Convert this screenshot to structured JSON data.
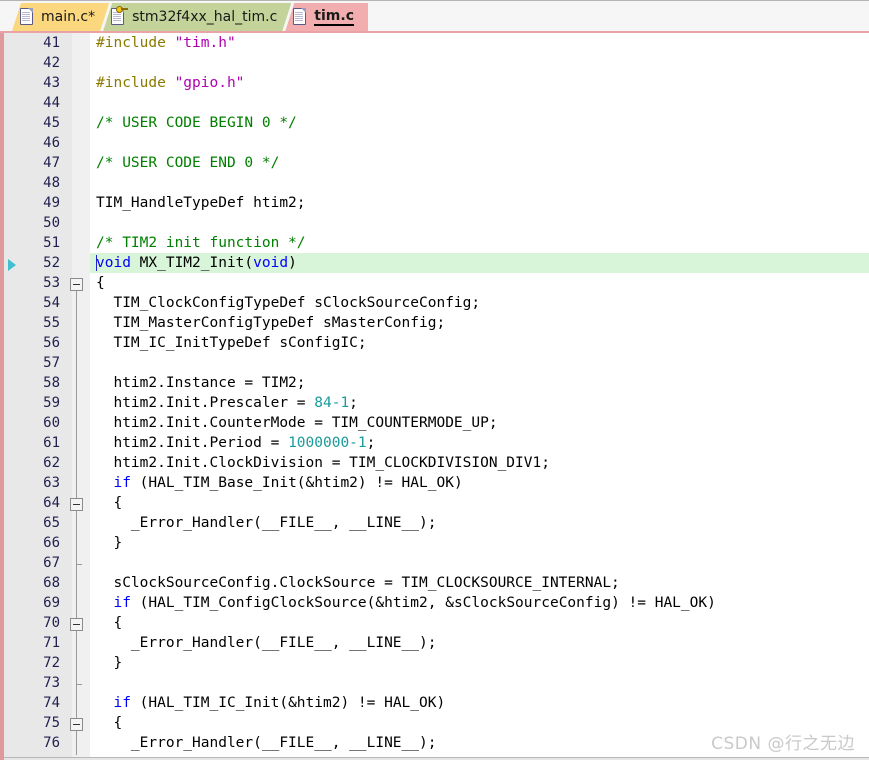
{
  "window": {
    "title": "tim.c",
    "accent_pink": "#e09a9e",
    "active_tab_color": "#f2aeae"
  },
  "tabs": [
    {
      "label": "main.c*",
      "icon": "file-icon",
      "color": "#fbd77e",
      "active": false,
      "readonly": false
    },
    {
      "label": "stm32f4xx_hal_tim.c",
      "icon": "file-locked-icon",
      "color": "#c3d39a",
      "active": false,
      "readonly": true
    },
    {
      "label": "tim.c",
      "icon": "file-icon",
      "color": "#f2aeae",
      "active": true,
      "readonly": false
    }
  ],
  "editor": {
    "first_line": 41,
    "current_line": 52,
    "exec_marker_line": 52,
    "fold_boxes": [
      53,
      64,
      70,
      75
    ],
    "fold_ticks": [
      67,
      73
    ],
    "fold_line_from": 53,
    "fold_line_to": 76,
    "line_numbers": [
      41,
      42,
      43,
      44,
      45,
      46,
      47,
      48,
      49,
      50,
      51,
      52,
      53,
      54,
      55,
      56,
      57,
      58,
      59,
      60,
      61,
      62,
      63,
      64,
      65,
      66,
      67,
      68,
      69,
      70,
      71,
      72,
      73,
      74,
      75,
      76
    ],
    "lines": [
      {
        "n": 41,
        "tokens": [
          {
            "t": "pre",
            "v": "#include "
          },
          {
            "t": "str",
            "v": "\"tim.h\""
          }
        ]
      },
      {
        "n": 42,
        "tokens": []
      },
      {
        "n": 43,
        "tokens": [
          {
            "t": "pre",
            "v": "#include "
          },
          {
            "t": "str",
            "v": "\"gpio.h\""
          }
        ]
      },
      {
        "n": 44,
        "tokens": []
      },
      {
        "n": 45,
        "tokens": [
          {
            "t": "cmt",
            "v": "/* USER CODE BEGIN 0 */"
          }
        ]
      },
      {
        "n": 46,
        "tokens": []
      },
      {
        "n": 47,
        "tokens": [
          {
            "t": "cmt",
            "v": "/* USER CODE END 0 */"
          }
        ]
      },
      {
        "n": 48,
        "tokens": []
      },
      {
        "n": 49,
        "tokens": [
          {
            "t": "txt",
            "v": "TIM_HandleTypeDef htim2;"
          }
        ]
      },
      {
        "n": 50,
        "tokens": []
      },
      {
        "n": 51,
        "tokens": [
          {
            "t": "cmt",
            "v": "/* TIM2 init function */"
          }
        ]
      },
      {
        "n": 52,
        "tokens": [
          {
            "t": "kw",
            "v": "void"
          },
          {
            "t": "txt",
            "v": " MX_TIM2_Init("
          },
          {
            "t": "kw",
            "v": "void"
          },
          {
            "t": "txt",
            "v": ")"
          }
        ]
      },
      {
        "n": 53,
        "tokens": [
          {
            "t": "txt",
            "v": "{"
          }
        ]
      },
      {
        "n": 54,
        "tokens": [
          {
            "t": "txt",
            "v": "  TIM_ClockConfigTypeDef sClockSourceConfig;"
          }
        ]
      },
      {
        "n": 55,
        "tokens": [
          {
            "t": "txt",
            "v": "  TIM_MasterConfigTypeDef sMasterConfig;"
          }
        ]
      },
      {
        "n": 56,
        "tokens": [
          {
            "t": "txt",
            "v": "  TIM_IC_InitTypeDef sConfigIC;"
          }
        ]
      },
      {
        "n": 57,
        "tokens": []
      },
      {
        "n": 58,
        "tokens": [
          {
            "t": "txt",
            "v": "  htim2.Instance = TIM2;"
          }
        ]
      },
      {
        "n": 59,
        "tokens": [
          {
            "t": "txt",
            "v": "  htim2.Init.Prescaler = "
          },
          {
            "t": "num",
            "v": "84-1"
          },
          {
            "t": "txt",
            "v": ";"
          }
        ]
      },
      {
        "n": 60,
        "tokens": [
          {
            "t": "txt",
            "v": "  htim2.Init.CounterMode = TIM_COUNTERMODE_UP;"
          }
        ]
      },
      {
        "n": 61,
        "tokens": [
          {
            "t": "txt",
            "v": "  htim2.Init.Period = "
          },
          {
            "t": "num",
            "v": "1000000-1"
          },
          {
            "t": "txt",
            "v": ";"
          }
        ]
      },
      {
        "n": 62,
        "tokens": [
          {
            "t": "txt",
            "v": "  htim2.Init.ClockDivision = TIM_CLOCKDIVISION_DIV1;"
          }
        ]
      },
      {
        "n": 63,
        "tokens": [
          {
            "t": "txt",
            "v": "  "
          },
          {
            "t": "kw",
            "v": "if"
          },
          {
            "t": "txt",
            "v": " (HAL_TIM_Base_Init(&htim2) != HAL_OK)"
          }
        ]
      },
      {
        "n": 64,
        "tokens": [
          {
            "t": "txt",
            "v": "  {"
          }
        ]
      },
      {
        "n": 65,
        "tokens": [
          {
            "t": "txt",
            "v": "    _Error_Handler(__FILE__, __LINE__);"
          }
        ]
      },
      {
        "n": 66,
        "tokens": [
          {
            "t": "txt",
            "v": "  }"
          }
        ]
      },
      {
        "n": 67,
        "tokens": []
      },
      {
        "n": 68,
        "tokens": [
          {
            "t": "txt",
            "v": "  sClockSourceConfig.ClockSource = TIM_CLOCKSOURCE_INTERNAL;"
          }
        ]
      },
      {
        "n": 69,
        "tokens": [
          {
            "t": "txt",
            "v": "  "
          },
          {
            "t": "kw",
            "v": "if"
          },
          {
            "t": "txt",
            "v": " (HAL_TIM_ConfigClockSource(&htim2, &sClockSourceConfig) != HAL_OK)"
          }
        ]
      },
      {
        "n": 70,
        "tokens": [
          {
            "t": "txt",
            "v": "  {"
          }
        ]
      },
      {
        "n": 71,
        "tokens": [
          {
            "t": "txt",
            "v": "    _Error_Handler(__FILE__, __LINE__);"
          }
        ]
      },
      {
        "n": 72,
        "tokens": [
          {
            "t": "txt",
            "v": "  }"
          }
        ]
      },
      {
        "n": 73,
        "tokens": []
      },
      {
        "n": 74,
        "tokens": [
          {
            "t": "txt",
            "v": "  "
          },
          {
            "t": "kw",
            "v": "if"
          },
          {
            "t": "txt",
            "v": " (HAL_TIM_IC_Init(&htim2) != HAL_OK)"
          }
        ]
      },
      {
        "n": 75,
        "tokens": [
          {
            "t": "txt",
            "v": "  {"
          }
        ]
      },
      {
        "n": 76,
        "tokens": [
          {
            "t": "txt",
            "v": "    _Error_Handler(__FILE__, __LINE__);"
          }
        ]
      }
    ]
  },
  "watermark": {
    "text": "CSDN @行之无边"
  }
}
